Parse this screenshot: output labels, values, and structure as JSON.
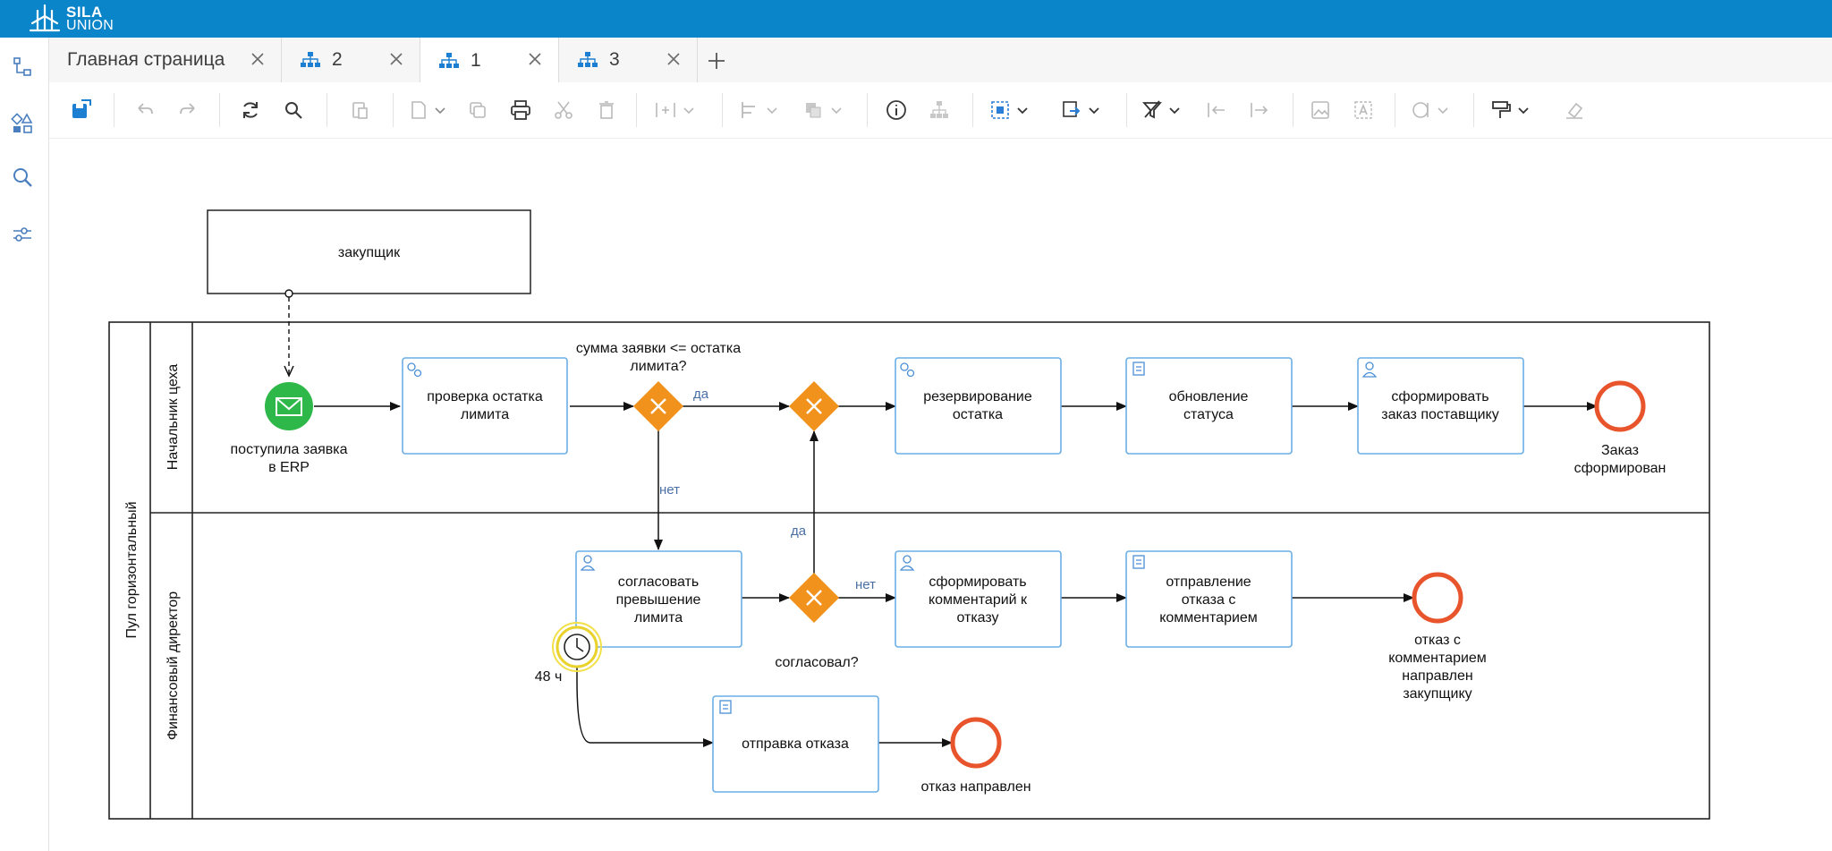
{
  "brand": {
    "line1": "SILA",
    "line2": "UNION"
  },
  "rail": [
    "diagram-tree-icon",
    "shapes-icon",
    "search-icon",
    "sliders-icon"
  ],
  "tabs": [
    {
      "label": "Главная страница",
      "icon": ""
    },
    {
      "label": "2",
      "icon": "diagram-icon"
    },
    {
      "label": "1",
      "icon": "diagram-icon"
    },
    {
      "label": "3",
      "icon": "diagram-icon"
    }
  ],
  "active_tab": 2,
  "colors": {
    "brand": "#0b85c9",
    "task": "#6aaee6",
    "gateway": "#f0921c",
    "start": "#2fb84a",
    "end": "#e8542b",
    "timer": "#e8d22b"
  },
  "diagram": {
    "participant": "закупщик",
    "pool": "Пул горизонтальный",
    "lanes": [
      "Начальник цеха",
      "Финансовый директор"
    ],
    "start_event": "поступила заявка в ERP",
    "tasks": {
      "check": "проверка остатка лимита",
      "reserve": "резервирование остатка",
      "update": "обновление статуса",
      "order": "сформировать заказ поставщику",
      "approve": "согласовать превышение лимита",
      "comment": "сформировать комментарий к отказу",
      "send_comment": "отправление отказа с комментарием",
      "send_refusal": "отправка отказа"
    },
    "gateways": {
      "g1": "сумма заявки <= остатка лимита?",
      "g3": "согласовал?"
    },
    "flows": {
      "yes1": "да",
      "no1": "нет",
      "yes2": "да",
      "no2": "нет"
    },
    "timer": "48 ч",
    "end_events": {
      "order_done": "Заказ сформирован",
      "refusal_comment": "отказ с комментарием направлен закупщику",
      "refusal": "отказ направлен"
    }
  }
}
